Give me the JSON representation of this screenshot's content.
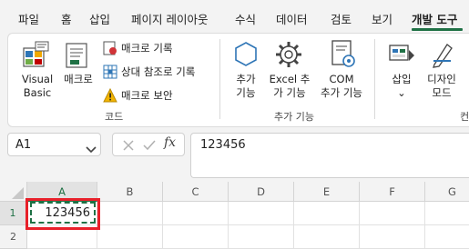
{
  "tabs": [
    "파일",
    "홈",
    "삽입",
    "페이지 레이아웃",
    "수식",
    "데이터",
    "검토",
    "보기",
    "개발 도구"
  ],
  "ribbon": {
    "code": {
      "visual_basic": [
        "Visual",
        "Basic"
      ],
      "macro": "매크로",
      "record_macro": "매크로 기록",
      "relative_ref": "상대 참조로 기록",
      "macro_security": "매크로 보안",
      "label": "코드"
    },
    "addins": {
      "addins": [
        "추가",
        "기능"
      ],
      "excel_addins": [
        "Excel 추",
        "가 기능"
      ],
      "com_addins": [
        "COM",
        "추가 기능"
      ],
      "label": "추가 기능"
    },
    "controls": {
      "insert": [
        "삽입",
        "⌄"
      ],
      "design_mode": [
        "디자인",
        "모드"
      ],
      "label_partial": "컨"
    }
  },
  "formula_bar": {
    "name_box": "A1",
    "fx": "fx",
    "value": "123456"
  },
  "grid": {
    "columns": [
      "A",
      "B",
      "C",
      "D",
      "E",
      "F",
      "G"
    ],
    "rows": [
      "1",
      "2"
    ],
    "a1_value": "123456"
  },
  "colors": {
    "accent": "#1f7145",
    "highlight": "#e8202a"
  }
}
